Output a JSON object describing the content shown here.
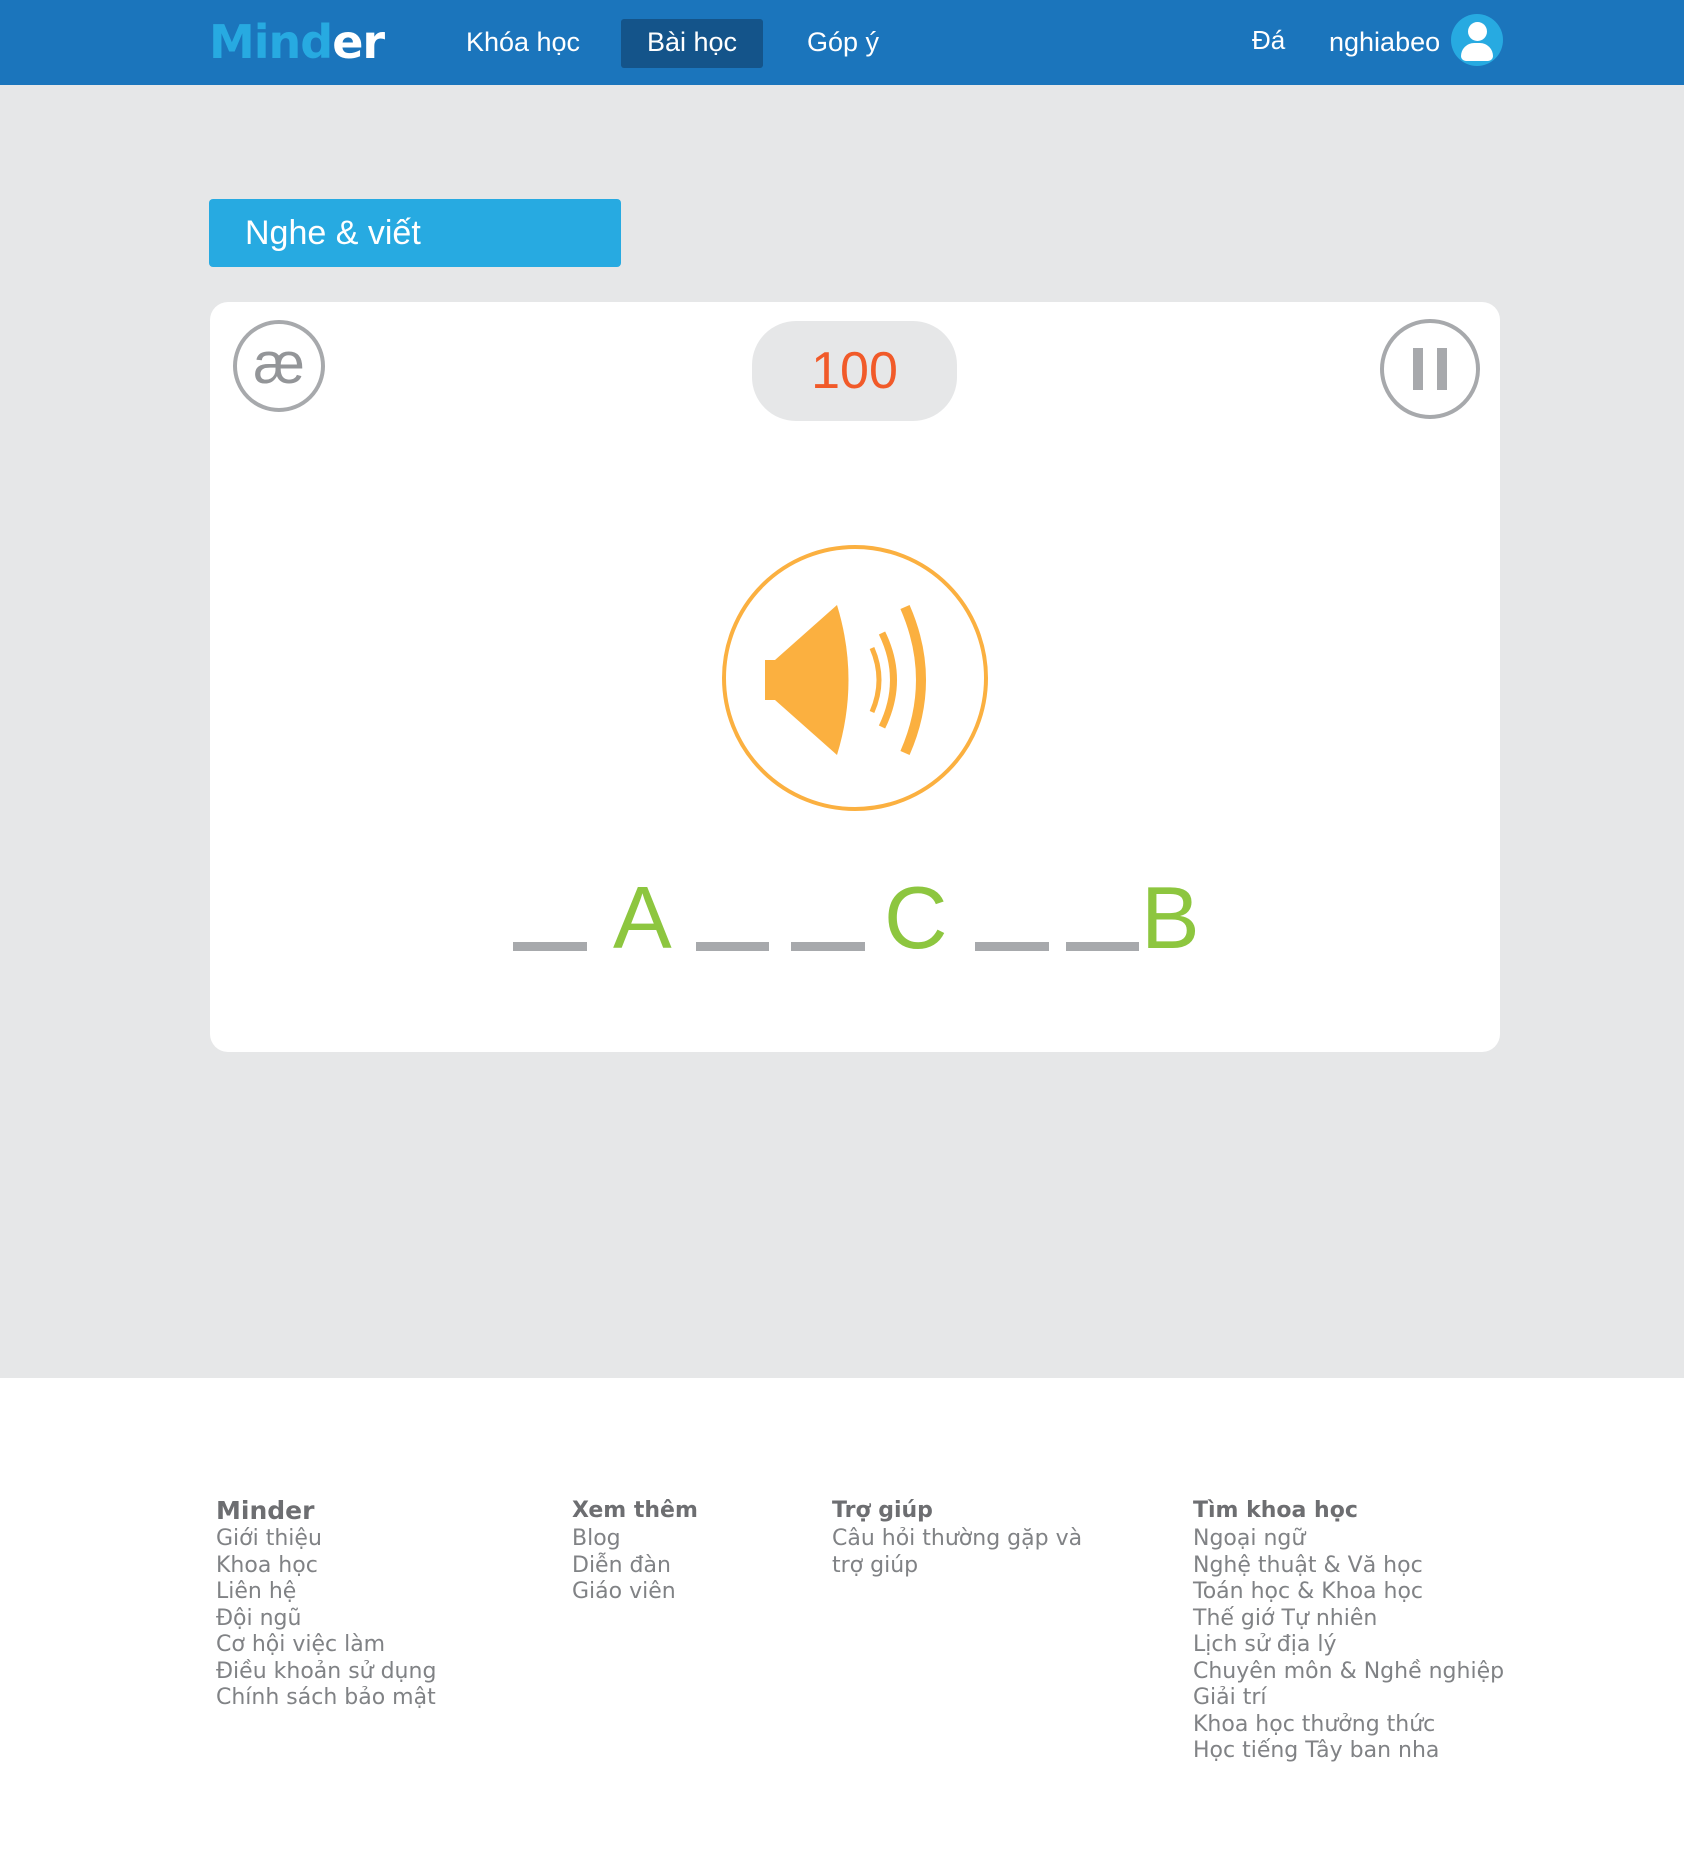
{
  "header": {
    "logo": {
      "part1": "Min",
      "part2": "d",
      "part3": "er"
    },
    "nav": [
      "Khóa học",
      "Bài học",
      "Góp ý"
    ],
    "active_nav": "Bài học",
    "language": "Đá",
    "username": "nghiabeo",
    "avatar_icon": "user-icon"
  },
  "lesson": {
    "title": "Nghe & viết",
    "ipa_symbol": "æ",
    "score": "100",
    "speaker_icon": "speaker-icon",
    "pause_icon": "pause-icon",
    "letters": [
      "A",
      "C",
      "B"
    ]
  },
  "footer": {
    "col1": {
      "heading": "Minder",
      "links": [
        "Giới thiệu",
        "Khoa học",
        "Liên hệ",
        "Đội ngũ",
        "Cơ hội việc làm",
        "Điều khoản sử dụng",
        "Chính sách bảo mật"
      ]
    },
    "col2": {
      "heading": "Xem thêm",
      "links": [
        "Blog",
        "Diễn đàn",
        "Giáo viên"
      ]
    },
    "col3": {
      "heading": "Trợ giúp",
      "links": [
        "Câu hỏi thường gặp và",
        "trợ giúp"
      ]
    },
    "col4": {
      "heading": "Tìm khoa học",
      "links": [
        "Ngoại ngữ",
        "Nghệ thuật & Vă học",
        "Toán học & Khoa học",
        "Thế giớ Tự nhiên",
        "Lịch sử địa lý",
        "Chuyên môn & Nghề nghiệp",
        "Giải trí",
        "Khoa học thưởng thức",
        "Học tiếng Tây ban nha"
      ]
    }
  },
  "colors": {
    "header_bg": "#1b75bc",
    "accent_blue": "#27aae1",
    "score_orange": "#f15a29",
    "speaker_orange": "#fbb040",
    "letter_green": "#8dc63f",
    "blank_grey": "#a7a9ac"
  }
}
